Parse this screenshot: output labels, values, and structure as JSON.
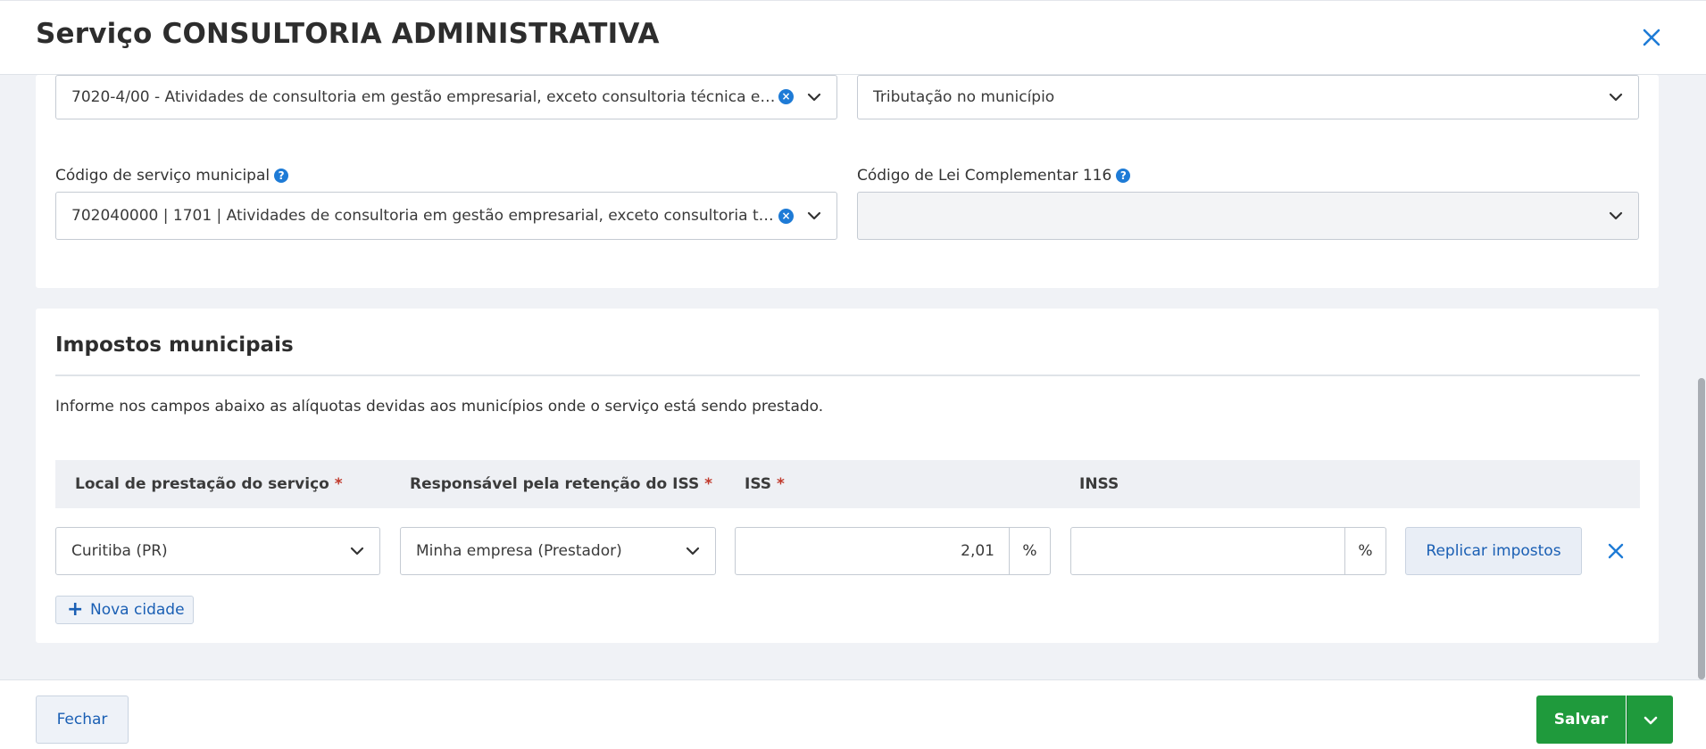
{
  "modal": {
    "title": "Serviço CONSULTORIA ADMINISTRATIVA"
  },
  "service": {
    "cnae_value": "7020-4/00 - Atividades de consultoria em gestão empresarial, exceto consultoria técnica es...",
    "tributacao_value": "Tributação no município",
    "municipal_code_label": "Código de serviço municipal",
    "municipal_code_value": "702040000 | 1701 | Atividades de consultoria em gestão empresarial, exceto consultoria téc...",
    "lc116_label": "Código de Lei Complementar 116",
    "lc116_value": ""
  },
  "taxes": {
    "title": "Impostos municipais",
    "description": "Informe nos campos abaixo as alíquotas devidas aos municípios onde o serviço está sendo prestado.",
    "columns": {
      "local": "Local de prestação do serviço",
      "responsavel": "Responsável pela retenção do ISS",
      "iss": "ISS",
      "inss": "INSS"
    },
    "required_mark": "*",
    "row": {
      "city": "Curitiba (PR)",
      "responsavel": "Minha empresa (Prestador)",
      "iss": "2,01",
      "inss": "",
      "percent_suffix": "%"
    },
    "replicate_label": "Replicar impostos",
    "add_city_label": "Nova cidade"
  },
  "footer": {
    "close_label": "Fechar",
    "save_label": "Salvar"
  },
  "colors": {
    "accent": "#1e7bd6",
    "link": "#1a5fb4",
    "save": "#1f9a3c",
    "required": "#c0392b"
  },
  "icons": {
    "close": "close-icon",
    "chevron": "chevron-down-icon",
    "clear": "clear-circle-icon",
    "help": "help-circle-icon",
    "plus": "plus-icon"
  }
}
